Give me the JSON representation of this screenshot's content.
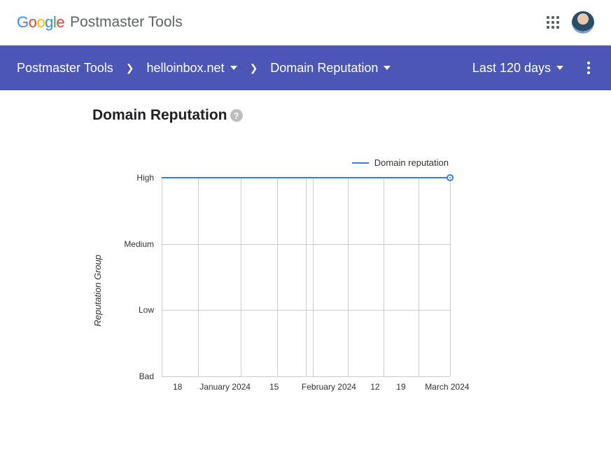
{
  "header": {
    "product": "Postmaster Tools"
  },
  "nav": {
    "root": "Postmaster Tools",
    "domain": "helloinbox.net",
    "report": "Domain Reputation",
    "range": "Last 120 days"
  },
  "page": {
    "title": "Domain Reputation",
    "ylabel": "Reputation Group",
    "legend": "Domain reputation"
  },
  "chart_data": {
    "type": "line",
    "ylabel": "Reputation Group",
    "y_categories": [
      "Bad",
      "Low",
      "Medium",
      "High"
    ],
    "ylim": [
      "Bad",
      "High"
    ],
    "x_ticks": [
      "18",
      "January 2024",
      "15",
      "February 2024",
      "12",
      "19",
      "March 2024"
    ],
    "series": [
      {
        "name": "Domain reputation",
        "value_const": "High",
        "color": "#3b7ddd"
      }
    ],
    "note": "Single flat line at High across the entire visible range (Dec 18 2023 – Mar 2024)"
  },
  "y_positions": {
    "High": 0,
    "Medium": 33.3,
    "Low": 66.7,
    "Bad": 100
  },
  "x_labels": [
    {
      "label": "18",
      "pct": 5.5
    },
    {
      "label": "January 2024",
      "pct": 22
    },
    {
      "label": "15",
      "pct": 39
    },
    {
      "label": "February 2024",
      "pct": 58
    },
    {
      "label": "12",
      "pct": 74
    },
    {
      "label": "19",
      "pct": 83
    },
    {
      "label": "March 2024",
      "pct": 99
    }
  ],
  "vline_pcts": [
    0,
    12.5,
    27.5,
    40,
    50,
    52.5,
    64.5,
    77,
    89,
    100
  ]
}
